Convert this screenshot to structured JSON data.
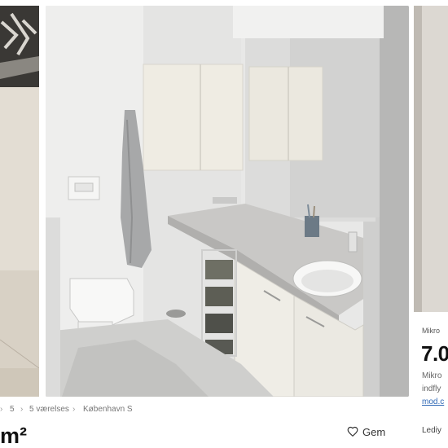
{
  "listing_right": {
    "location": "Mikro",
    "price": "7.0",
    "description_line1": "Mikro",
    "description_line2": "indfly",
    "more_link": "mod.c",
    "rent_label": "Lediy"
  },
  "breadcrumbs": [
    {
      "label": "5"
    },
    {
      "label": "5 værelses"
    },
    {
      "label": "København S"
    }
  ],
  "breadcrumb_separator": "›",
  "title": "m²",
  "save_label": "Gem",
  "icons": {
    "save": "heart-outline-icon"
  }
}
